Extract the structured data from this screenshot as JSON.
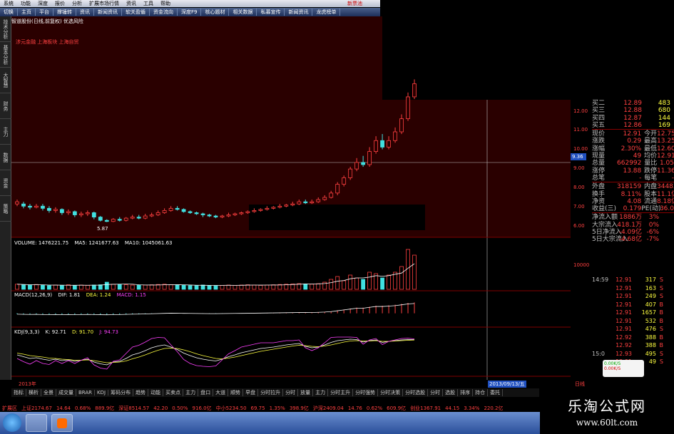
{
  "menu": [
    "系统",
    "功能",
    "深度",
    "报价",
    "分析",
    "扩展市场行情",
    "资讯",
    "工具",
    "帮助"
  ],
  "menu_alert": "新票池",
  "toolbar": [
    "切换",
    "主页",
    "平台",
    "撑锤转",
    "资讯",
    "新闻资讯",
    "软关盈循",
    "资金流向",
    "深度F9",
    "核心题材",
    "相关数据",
    "私募宣传",
    "新闻资讯",
    "龙虎榜单"
  ],
  "stock_title": "智道股份(日线,前复权) 优选风险",
  "red_labels": "涉元金融 上海板块 上海自贸",
  "left_tabs": [
    "技术分析",
    "基本分析",
    "大智慧",
    "财务",
    "主力",
    "数据",
    "资金",
    "策略"
  ],
  "volume_line": {
    "label": "VOLUME: 1476221.75",
    "ma5": "MA5: 1241677.63",
    "ma10": "MA10: 1045061.63"
  },
  "macd_line": {
    "label": "MACD(12,26,9)",
    "dif": "DIF: 1.81",
    "dea": "DEA: 1.24",
    "macd": "MACD: 1.15"
  },
  "kdj_line": {
    "label": "KDJ(9,3,3)",
    "k": "K: 92.71",
    "d": "D: 91.70",
    "j": "J: 94.73"
  },
  "low_marker": "5.87",
  "cross_value": "9.36",
  "y_ticks": [
    "12.00",
    "11.00",
    "10.00",
    "9.00",
    "8.00",
    "7.00",
    "6.00"
  ],
  "vol_ticks": [
    "10000"
  ],
  "date_labels": {
    "left": "2013年",
    "cursor": "2013/09/13/五",
    "right": "日线"
  },
  "quote": [
    {
      "l": "买二",
      "v": "12.89",
      "v2": "483"
    },
    {
      "l": "买三",
      "v": "12.88",
      "v2": "680"
    },
    {
      "l": "买四",
      "v": "12.87",
      "v2": "144"
    },
    {
      "l": "买五",
      "v": "12.86",
      "v2": "169"
    },
    {
      "l": "现价",
      "v": "12.91",
      "l2": "今开",
      "v3": "12.75"
    },
    {
      "l": "涨跌",
      "v": "0.29",
      "l2": "最高",
      "v3": "13.25"
    },
    {
      "l": "涨幅",
      "v": "2.30%",
      "l2": "最低",
      "v3": "12.60"
    },
    {
      "l": "现量",
      "v": "49",
      "l2": "均价",
      "v3": "12.91"
    },
    {
      "l": "总量",
      "v": "662992",
      "l2": "量比",
      "v3": "1.05"
    },
    {
      "l": "涨停",
      "v": "13.88",
      "l2": "跌停",
      "v3": "11.36"
    },
    {
      "l": "总笔",
      "v": "-",
      "l2": "每笔",
      "v3": "-"
    },
    {
      "l": "外盘",
      "v": "318159",
      "l2": "内盘",
      "v3": "344833"
    },
    {
      "l": "换手",
      "v": "8.11%",
      "l2": "股本",
      "v3": "11.1亿"
    },
    {
      "l": "净资",
      "v": "4.08",
      "l2": "流通",
      "v3": "8.18亿"
    },
    {
      "l": "收益(三)",
      "v": "0.179",
      "l2": "PE(动)",
      "v3": "36.0"
    },
    {
      "l": "净流入额",
      "v": "1886万",
      "v3": "3%"
    },
    {
      "l": "大宗流入",
      "v": "418.1万",
      "v3": "0%"
    },
    {
      "l": "5日净流入",
      "v": "-4.09亿",
      "v3": "-6%"
    },
    {
      "l": "5日大宗流入",
      "v": "-4.68亿",
      "v3": "-7%"
    }
  ],
  "ticks": [
    {
      "t": "14:59",
      "p": "12.91",
      "v": "317",
      "b": "S"
    },
    {
      "t": "",
      "p": "12.91",
      "v": "163",
      "b": "S"
    },
    {
      "t": "",
      "p": "12.91",
      "v": "249",
      "b": "S"
    },
    {
      "t": "",
      "p": "12.91",
      "v": "407",
      "b": "B"
    },
    {
      "t": "",
      "p": "12.91",
      "v": "1657",
      "b": "B"
    },
    {
      "t": "",
      "p": "12.91",
      "v": "532",
      "b": "B"
    },
    {
      "t": "",
      "p": "12.91",
      "v": "476",
      "b": "S"
    },
    {
      "t": "",
      "p": "12.92",
      "v": "388",
      "b": "B"
    },
    {
      "t": "",
      "p": "12.92",
      "v": "388",
      "b": "B"
    },
    {
      "t": "15:0",
      "p": "12.93",
      "v": "495",
      "b": "S"
    },
    {
      "t": "",
      "p": "12.91",
      "v": "49",
      "b": "S"
    }
  ],
  "mini": {
    "up": "0.00K/S",
    "down": "0.00K/S"
  },
  "bottom_tabs": [
    "指标",
    "横析",
    "全景",
    "成交量",
    "BRAR",
    "KDJ",
    "筹码分布",
    "趋势",
    "动能",
    "买卖点",
    "主力",
    "盘口",
    "大道",
    "顺势",
    "早盘",
    "分时拉升",
    "分时",
    "放量",
    "主力",
    "分时主升",
    "分时强势",
    "分时决策",
    "分时选股",
    "分时",
    "选股",
    "排序",
    "持仓",
    "委托"
  ],
  "index_bar": [
    "扩展区",
    "上证2174.67",
    "14.64",
    "0.68%",
    "889.9亿",
    "深证8514.57",
    "42.20",
    "0.50%",
    "916.0亿",
    "中小5234.50",
    "69.75",
    "1.35%",
    "398.9亿",
    "沪深2409.04",
    "14.76",
    "0.62%",
    "609.9亿",
    "创业1367.91",
    "44.15",
    "3.34%",
    "220.2亿"
  ],
  "watermark": {
    "title": "乐淘公式网",
    "url": "www.60lt.com"
  },
  "colors": {
    "up": "#ff4040",
    "down": "#40e0e0",
    "bg_main": "#2a0000",
    "bg": "#000000"
  },
  "chart_data": {
    "type": "candlestick",
    "title": "",
    "ylim": [
      5.5,
      13
    ],
    "candles": [
      [
        6.8,
        6.7,
        6.9,
        6.6,
        0
      ],
      [
        6.7,
        6.6,
        6.8,
        6.5,
        1
      ],
      [
        6.6,
        6.55,
        6.7,
        6.45,
        1
      ],
      [
        6.55,
        6.6,
        6.7,
        6.5,
        0
      ],
      [
        6.6,
        6.5,
        6.7,
        6.4,
        1
      ],
      [
        6.5,
        6.4,
        6.6,
        6.3,
        1
      ],
      [
        6.4,
        6.45,
        6.55,
        6.3,
        0
      ],
      [
        6.45,
        6.3,
        6.5,
        6.2,
        1
      ],
      [
        6.3,
        6.35,
        6.45,
        6.2,
        0
      ],
      [
        6.35,
        6.2,
        6.4,
        6.1,
        1
      ],
      [
        6.2,
        6.25,
        6.35,
        6.1,
        0
      ],
      [
        6.25,
        6.3,
        6.4,
        6.15,
        0
      ],
      [
        6.3,
        6.1,
        6.35,
        6.0,
        1
      ],
      [
        6.1,
        5.95,
        6.15,
        5.9,
        1
      ],
      [
        5.95,
        5.9,
        6.0,
        5.87,
        1
      ],
      [
        5.9,
        6.0,
        6.05,
        5.87,
        0
      ],
      [
        6.0,
        5.95,
        6.1,
        5.9,
        1
      ],
      [
        5.95,
        6.05,
        6.1,
        5.9,
        0
      ],
      [
        6.05,
        6.1,
        6.2,
        6.0,
        0
      ],
      [
        6.1,
        6.05,
        6.2,
        6.0,
        1
      ],
      [
        6.05,
        6.15,
        6.25,
        6.0,
        0
      ],
      [
        6.15,
        6.2,
        6.3,
        6.1,
        0
      ],
      [
        6.2,
        6.3,
        6.4,
        6.15,
        0
      ],
      [
        6.3,
        6.4,
        6.5,
        6.25,
        0
      ],
      [
        6.4,
        6.5,
        6.6,
        6.35,
        0
      ],
      [
        6.5,
        6.45,
        6.6,
        6.4,
        1
      ],
      [
        6.45,
        6.35,
        6.5,
        6.3,
        1
      ],
      [
        6.35,
        6.3,
        6.4,
        6.25,
        1
      ],
      [
        6.3,
        6.25,
        6.35,
        6.2,
        1
      ],
      [
        6.25,
        6.2,
        6.3,
        6.1,
        1
      ],
      [
        6.2,
        6.15,
        6.25,
        6.1,
        1
      ],
      [
        6.15,
        6.1,
        6.2,
        6.05,
        1
      ],
      [
        6.1,
        6.15,
        6.2,
        6.05,
        0
      ],
      [
        6.15,
        6.2,
        6.3,
        6.1,
        0
      ],
      [
        6.2,
        6.25,
        6.3,
        6.15,
        0
      ],
      [
        6.25,
        6.3,
        6.35,
        6.2,
        0
      ],
      [
        6.3,
        6.35,
        6.4,
        6.25,
        0
      ],
      [
        6.35,
        6.4,
        6.5,
        6.3,
        0
      ],
      [
        6.4,
        6.45,
        6.5,
        6.35,
        0
      ],
      [
        6.45,
        6.5,
        6.6,
        6.4,
        0
      ],
      [
        6.5,
        6.55,
        6.6,
        6.45,
        0
      ],
      [
        6.55,
        6.6,
        6.7,
        6.5,
        0
      ],
      [
        6.6,
        6.65,
        6.7,
        6.55,
        0
      ],
      [
        6.65,
        6.7,
        6.8,
        6.6,
        0
      ],
      [
        6.7,
        6.8,
        6.9,
        6.65,
        0
      ],
      [
        6.8,
        6.75,
        6.9,
        6.7,
        1
      ],
      [
        6.75,
        6.8,
        6.9,
        6.7,
        0
      ],
      [
        6.8,
        6.9,
        7.0,
        6.75,
        0
      ],
      [
        6.9,
        7.0,
        7.1,
        6.85,
        0
      ],
      [
        7.0,
        7.2,
        7.3,
        6.95,
        0
      ],
      [
        7.2,
        7.6,
        7.7,
        7.1,
        0
      ],
      [
        7.6,
        7.9,
        8.0,
        7.5,
        0
      ],
      [
        7.9,
        8.3,
        8.4,
        7.8,
        0
      ],
      [
        8.3,
        8.6,
        8.8,
        8.2,
        0
      ],
      [
        8.6,
        8.5,
        8.9,
        8.4,
        1
      ],
      [
        8.5,
        9.1,
        9.3,
        8.4,
        0
      ],
      [
        9.1,
        9.6,
        9.8,
        9.0,
        0
      ],
      [
        9.6,
        9.3,
        9.9,
        9.2,
        1
      ],
      [
        9.3,
        9.6,
        9.8,
        9.2,
        0
      ],
      [
        9.6,
        10.0,
        10.2,
        9.5,
        0
      ],
      [
        10.0,
        10.6,
        10.8,
        9.9,
        0
      ],
      [
        10.6,
        11.6,
        11.8,
        10.5,
        0
      ],
      [
        11.6,
        12.2,
        12.4,
        11.5,
        0
      ]
    ],
    "volume_ylim": [
      0,
      15000
    ],
    "volume": [
      1800,
      1600,
      1500,
      1700,
      1400,
      1300,
      1500,
      1400,
      1600,
      1300,
      1500,
      1400,
      1500,
      1600,
      2500,
      1800,
      1700,
      1600,
      1500,
      1400,
      1500,
      1600,
      1700,
      1800,
      1600,
      1500,
      1400,
      1300,
      1400,
      1500,
      1400,
      1300,
      1400,
      1500,
      1400,
      1500,
      1600,
      1500,
      1400,
      1500,
      1600,
      1700,
      1800,
      1900,
      2000,
      1900,
      1800,
      2000,
      2500,
      3500,
      4500,
      3000,
      5000,
      4000,
      3500,
      6000,
      5500,
      4000,
      5000,
      6000,
      8000,
      14000,
      12000
    ],
    "macd_ylim": [
      -1,
      2
    ],
    "macd": [
      -0.1,
      -0.12,
      -0.13,
      -0.12,
      -0.14,
      -0.15,
      -0.14,
      -0.15,
      -0.14,
      -0.15,
      -0.14,
      -0.13,
      -0.14,
      -0.16,
      -0.17,
      -0.15,
      -0.14,
      -0.12,
      -0.1,
      -0.09,
      -0.07,
      -0.05,
      -0.03,
      0,
      0.02,
      0.01,
      0,
      -0.01,
      -0.02,
      -0.03,
      -0.04,
      -0.04,
      -0.03,
      -0.02,
      -0.01,
      0,
      0.01,
      0.02,
      0.03,
      0.04,
      0.05,
      0.06,
      0.07,
      0.08,
      0.1,
      0.09,
      0.1,
      0.12,
      0.15,
      0.2,
      0.3,
      0.4,
      0.5,
      0.6,
      0.6,
      0.7,
      0.8,
      0.8,
      0.85,
      0.9,
      1.0,
      1.1,
      1.15
    ],
    "kdj_ylim": [
      0,
      100
    ],
    "kdj_k": [
      50,
      45,
      40,
      42,
      38,
      35,
      38,
      34,
      36,
      32,
      35,
      38,
      30,
      25,
      22,
      30,
      32,
      40,
      50,
      55,
      62,
      70,
      75,
      78,
      72,
      65,
      55,
      48,
      42,
      38,
      35,
      33,
      38,
      45,
      50,
      56,
      60,
      64,
      68,
      70,
      72,
      75,
      78,
      80,
      82,
      74,
      70,
      72,
      78,
      85,
      90,
      92,
      94,
      93,
      86,
      90,
      92,
      85,
      88,
      90,
      92,
      93,
      92.7
    ],
    "kdj_d": [
      55,
      52,
      48,
      46,
      44,
      41,
      40,
      38,
      37,
      35,
      35,
      36,
      34,
      31,
      28,
      29,
      30,
      33,
      39,
      44,
      50,
      57,
      63,
      68,
      69,
      68,
      64,
      59,
      53,
      48,
      44,
      40,
      39,
      41,
      44,
      48,
      52,
      56,
      60,
      63,
      66,
      69,
      72,
      75,
      77,
      76,
      74,
      73,
      75,
      78,
      82,
      86,
      89,
      90,
      89,
      89,
      90,
      88,
      88,
      89,
      90,
      91,
      91.7
    ],
    "kdj_j": [
      40,
      31,
      24,
      34,
      26,
      23,
      34,
      26,
      34,
      26,
      35,
      42,
      22,
      13,
      10,
      32,
      36,
      54,
      72,
      77,
      86,
      96,
      99,
      98,
      78,
      59,
      37,
      26,
      20,
      18,
      17,
      19,
      36,
      53,
      62,
      72,
      76,
      80,
      84,
      84,
      84,
      87,
      90,
      90,
      92,
      70,
      62,
      70,
      84,
      99,
      100,
      100,
      100,
      99,
      80,
      92,
      96,
      79,
      88,
      92,
      96,
      97,
      94.7
    ]
  }
}
